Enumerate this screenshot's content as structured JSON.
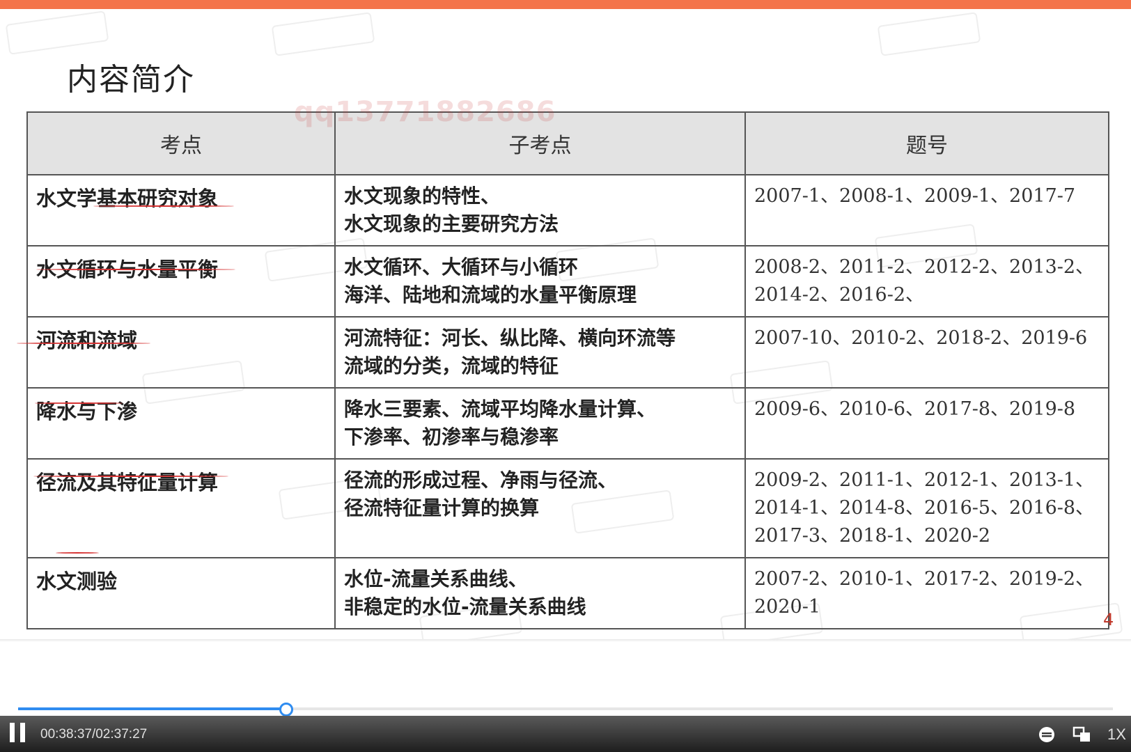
{
  "slide": {
    "title": "内容简介",
    "watermark": "qq13771882686",
    "page_number": "4"
  },
  "table": {
    "headers": [
      "考点",
      "子考点",
      "题号"
    ],
    "rows": [
      {
        "topic": "水文学基本研究对象",
        "subtopics": [
          "水文现象的特性、",
          "水文现象的主要研究方法"
        ],
        "numbers": [
          "2007-1、2008-1、2009-1、2017-7"
        ]
      },
      {
        "topic": "水文循环与水量平衡",
        "subtopics": [
          "水文循环、大循环与小循环",
          "海洋、陆地和流域的水量平衡原理"
        ],
        "numbers": [
          "2008-2、2011-2、2012-2、2013-2、",
          "2014-2、2016-2、"
        ]
      },
      {
        "topic": "河流和流域",
        "subtopics": [
          "河流特征：河长、纵比降、横向环流等",
          "流域的分类，流域的特征"
        ],
        "numbers": [
          "2007-10、2010-2、2018-2、2019-6"
        ]
      },
      {
        "topic": "降水与下渗",
        "subtopics": [
          "降水三要素、流域平均降水量计算、",
          "下渗率、初渗率与稳渗率"
        ],
        "numbers": [
          "2009-6、2010-6、2017-8、2019-8"
        ]
      },
      {
        "topic": "径流及其特征量计算",
        "subtopics": [
          "径流的形成过程、净雨与径流、",
          "径流特征量计算的换算"
        ],
        "numbers": [
          "2009-2、2011-1、2012-1、2013-1、",
          "2014-1、2014-8、2016-5、2016-8、",
          "2017-3、2018-1、2020-2"
        ]
      },
      {
        "topic": "水文测验",
        "subtopics": [
          "水位-流量关系曲线、",
          "非稳定的水位-流量关系曲线"
        ],
        "numbers": [
          "2007-2、2010-1、2017-2、2019-2、",
          "2020-1"
        ]
      }
    ]
  },
  "player": {
    "time_display": "00:38:37/02:37:27",
    "speed_label": "1X",
    "progress": 0.245,
    "accent_color": "#2f8cf0",
    "icons": [
      "pause-icon",
      "subtitle-icon",
      "fullscreen-icon"
    ]
  },
  "colors": {
    "top_bar": "#f4744a",
    "header_bg": "#e3e3e3",
    "annotation": "#d63333"
  }
}
